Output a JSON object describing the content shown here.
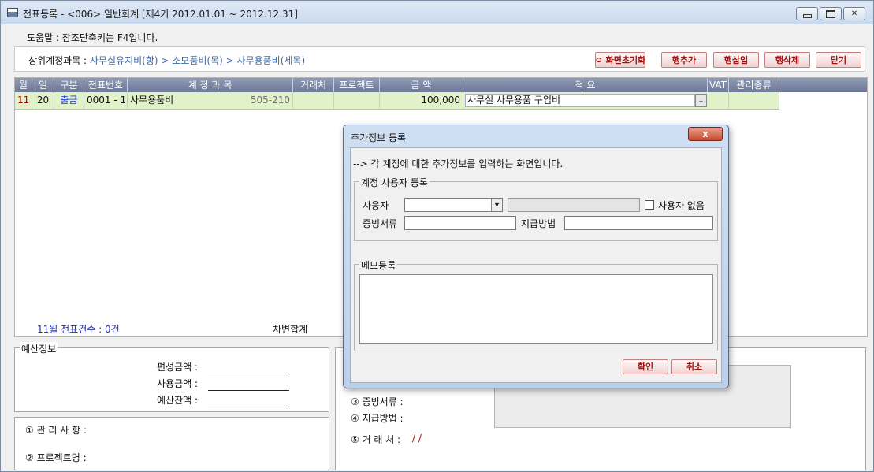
{
  "window": {
    "title": "전표등록 - <006> 일반회계  [제4기 2012.01.01 ~ 2012.12.31]"
  },
  "help": {
    "text": "도움말 :  참조단축키는 F4입니다."
  },
  "crumb": {
    "label": "상위계정과목 : ",
    "path": "사무실유지비(항) > 소모품비(목) > 사무용품비(세목)"
  },
  "toolbar": {
    "reset_label": "ㅇ 화면초기화",
    "add_row_label": "행추가",
    "insert_row_label": "행삽입",
    "delete_row_label": "행삭제",
    "close_label": "닫기"
  },
  "grid": {
    "columns": [
      "월",
      "일",
      "구분",
      "전표번호",
      "계 정 과 목",
      "거래처",
      "프로젝트",
      "금  액",
      "적                     요",
      "VAT",
      "관리종류"
    ],
    "rows": [
      {
        "month": "11",
        "day": "20",
        "type": "출금",
        "voucher_no": "0001 - 1",
        "account": "사무용품비",
        "account_code": "505-210",
        "client": "",
        "project": "",
        "amount": "100,000",
        "memo": "사무실 사무용품 구입비",
        "vat": "",
        "mgmt_type": ""
      }
    ],
    "footer_count": "11월 전표건수 : 0건",
    "footer_sum": "차변합계",
    "lookup_button": ".."
  },
  "budget": {
    "legend": "예산정보",
    "fields": [
      {
        "label": "편성금액 :"
      },
      {
        "label": "사용금액 :"
      },
      {
        "label": "예산잔액 :"
      }
    ]
  },
  "mgmt": {
    "items": [
      "① 관 리 사 항 :",
      "② 프로젝트명 :"
    ]
  },
  "info": {
    "items": [
      "③ 증빙서류 :",
      "④ 지급방법 :",
      "⑤ 거 래 처  :"
    ],
    "client_value": "/ /"
  },
  "dialog": {
    "title": "추가정보 등록",
    "close": "x",
    "description": "--> 각 계정에 대한 추가정보를 입력하는 화면입니다.",
    "user_group": {
      "legend": "계정 사용자 등록",
      "user_label": "사용자",
      "user_value": "",
      "no_user_label": "사용자 없음",
      "no_user_checked": false,
      "evidence_label": "증빙서류",
      "evidence_value": "",
      "payment_label": "지급방법",
      "payment_value": ""
    },
    "memo_group": {
      "legend": "메모등록",
      "memo_value": ""
    },
    "ok_label": "확인",
    "cancel_label": "취소"
  }
}
